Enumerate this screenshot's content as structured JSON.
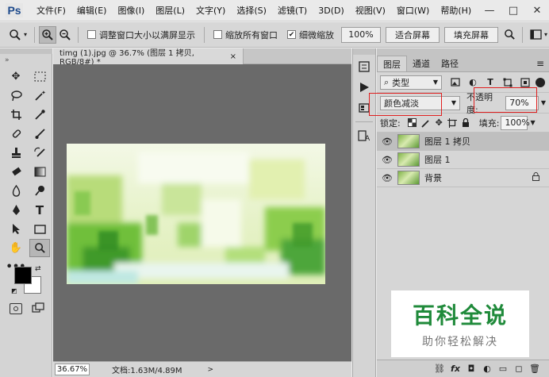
{
  "app": {
    "logo": "Ps"
  },
  "menu": [
    "文件(F)",
    "编辑(E)",
    "图像(I)",
    "图层(L)",
    "文字(Y)",
    "选择(S)",
    "滤镜(T)",
    "3D(D)",
    "视图(V)",
    "窗口(W)",
    "帮助(H)"
  ],
  "window_controls": {
    "minimize": "—",
    "maximize": "□",
    "close": "✕"
  },
  "options": {
    "resize_windows": "调整窗口大小以满屏显示",
    "zoom_all": "缩放所有窗口",
    "scrubby_zoom": "细微缩放",
    "zoom_value": "100%",
    "fit_screen": "适合屏幕",
    "fill_screen": "填充屏幕"
  },
  "document": {
    "tab_title": "timg (1).jpg @ 36.7% (图层 1 拷贝, RGB/8#) *",
    "tab_close": "×"
  },
  "status": {
    "zoom": "36.67%",
    "doc_info": "文档:1.63M/4.89M",
    "arrow": ">"
  },
  "layers_panel": {
    "tabs": [
      "图层",
      "通道",
      "路径"
    ],
    "filter_kind": "类型",
    "blend_mode": "颜色减淡",
    "opacity_label": "不透明度:",
    "opacity_value": "70%",
    "lock_label": "锁定:",
    "fill_label": "填充:",
    "fill_value": "100%",
    "layers": [
      {
        "name": "图层 1 拷贝",
        "selected": true,
        "locked": false
      },
      {
        "name": "图层 1",
        "selected": false,
        "locked": false
      },
      {
        "name": "背景",
        "selected": false,
        "locked": true
      }
    ]
  },
  "watermark": {
    "title": "百科全说",
    "subtitle": "助你轻松解决"
  },
  "colors": {
    "foreground": "#000000",
    "background": "#ffffff",
    "highlight": "#e02020",
    "watermark_green": "#1f8a3a"
  }
}
